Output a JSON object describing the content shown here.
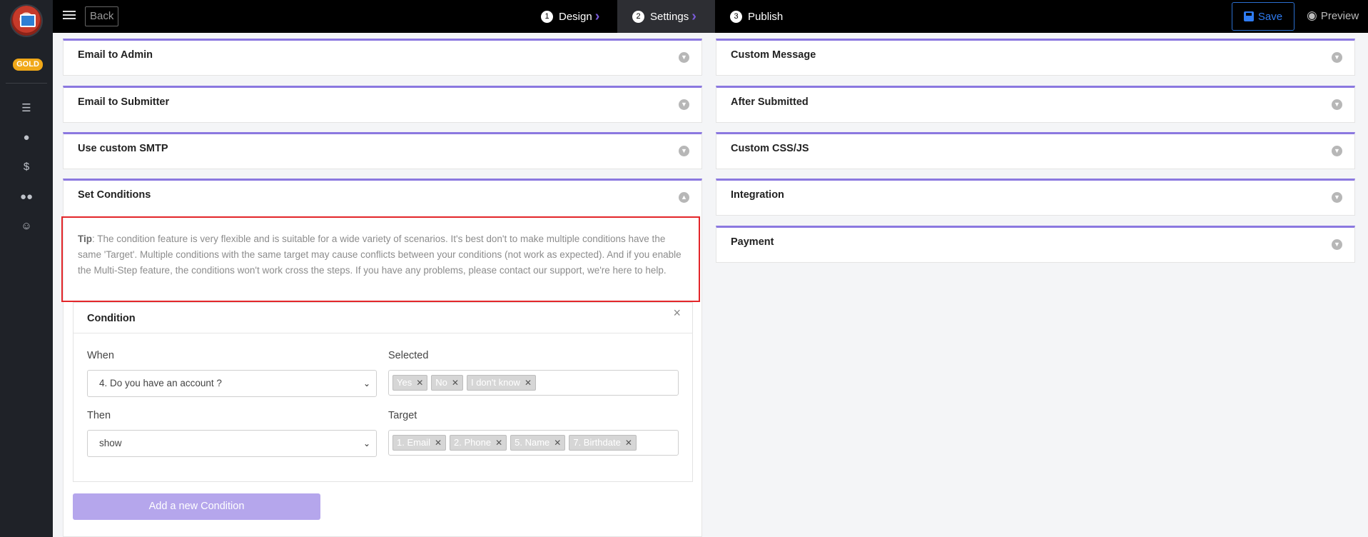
{
  "sidebar": {
    "badge": "GOLD",
    "icons": [
      "list-icon",
      "user-icon",
      "dollar-icon",
      "users-icon",
      "smile-icon"
    ]
  },
  "topbar": {
    "back_label": "Back",
    "steps": [
      {
        "num": "1",
        "label": "Design"
      },
      {
        "num": "2",
        "label": "Settings"
      },
      {
        "num": "3",
        "label": "Publish"
      }
    ],
    "save_label": "Save",
    "preview_label": "Preview"
  },
  "left_panels": [
    {
      "title": "Email to Admin"
    },
    {
      "title": "Email to Submitter"
    },
    {
      "title": "Use custom SMTP"
    },
    {
      "title": "Set Conditions"
    }
  ],
  "right_panels": [
    {
      "title": "Custom Message"
    },
    {
      "title": "After Submitted"
    },
    {
      "title": "Custom CSS/JS"
    },
    {
      "title": "Integration"
    },
    {
      "title": "Payment"
    }
  ],
  "tip": {
    "label": "Tip",
    "text": ": The condition feature is very flexible and is suitable for a wide variety of scenarios. It's best don't to make multiple conditions have the same 'Target'. Multiple conditions with the same target may cause conflicts between your conditions (not work as expected). And if you enable the Multi-Step feature, the conditions won't work cross the steps. If you have any problems, please contact our support, we're here to help."
  },
  "condition": {
    "title": "Condition",
    "close": "×",
    "when_label": "When",
    "when_value": "4. Do you have an account ?",
    "selected_label": "Selected",
    "selected_tags": [
      "Yes",
      "No",
      "I don't know"
    ],
    "then_label": "Then",
    "then_value": "show",
    "target_label": "Target",
    "target_tags": [
      "1. Email",
      "2. Phone",
      "5. Name",
      "7. Birthdate"
    ]
  },
  "add_condition_label": "Add a new Condition",
  "colors": {
    "accent": "#8b78e0",
    "highlight_border": "#e3262a",
    "gold": "#f0a818",
    "save_blue": "#2f7cf2"
  }
}
